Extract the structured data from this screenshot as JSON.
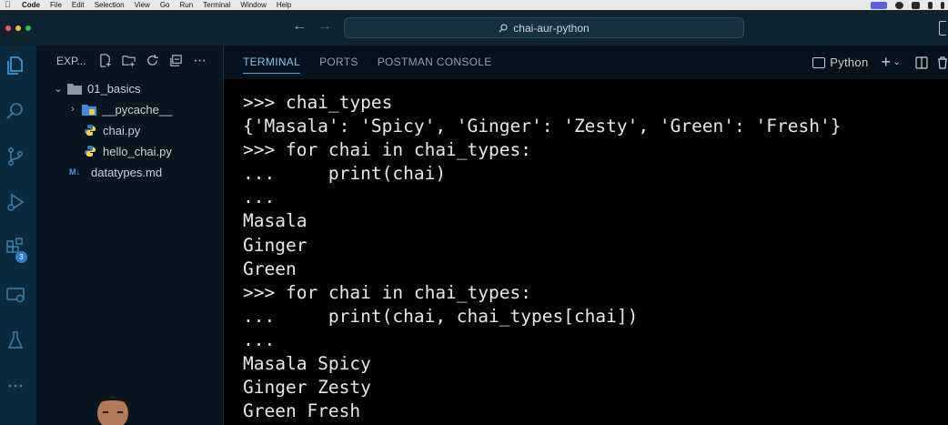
{
  "menubar": {
    "app": "Code",
    "items": [
      "File",
      "Edit",
      "Selection",
      "View",
      "Go",
      "Run",
      "Terminal",
      "Window",
      "Help"
    ]
  },
  "titlebar": {
    "search_text": "chai-aur-python",
    "icons": [
      "arrow-left-icon",
      "arrow-right-icon",
      "search-icon",
      "toggle-layout-icon"
    ]
  },
  "activity_bar": {
    "items": [
      "explorer",
      "search",
      "source-control",
      "run-and-debug",
      "extensions",
      "remote-explorer",
      "testing",
      "more"
    ],
    "extensions_badge": "3"
  },
  "explorer": {
    "title": "EXP...",
    "folder": "01_basics",
    "items": [
      {
        "name": "__pycache__",
        "type": "folder"
      },
      {
        "name": "chai.py",
        "type": "python"
      },
      {
        "name": "hello_chai.py",
        "type": "python"
      },
      {
        "name": "datatypes.md",
        "type": "markdown",
        "prefix": "M↓"
      }
    ]
  },
  "panel": {
    "tabs": [
      "TERMINAL",
      "PORTS",
      "POSTMAN CONSOLE"
    ],
    "active_tab": "TERMINAL",
    "shell_label": "Python"
  },
  "terminal_lines": [
    ">>> chai_types",
    "{'Masala': 'Spicy', 'Ginger': 'Zesty', 'Green': 'Fresh'}",
    ">>> for chai in chai_types:",
    "...     print(chai)",
    "...",
    "Masala",
    "Ginger",
    "Green",
    ">>> for chai in chai_types:",
    "...     print(chai, chai_types[chai])",
    "...",
    "Masala Spicy",
    "Ginger Zesty",
    "Green Fresh"
  ],
  "colors": {
    "accent": "#4aa3df",
    "badge": "#2f7fcf",
    "terminal_bg": "#000000",
    "sidebar_bg": "#07151f"
  }
}
